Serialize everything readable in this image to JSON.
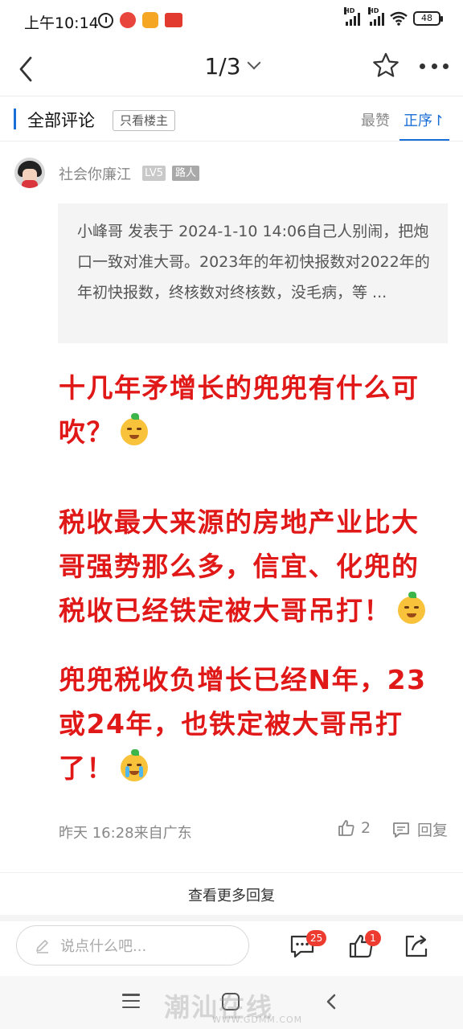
{
  "status_bar": {
    "time": "上午10:14",
    "net_label_1": "HD",
    "net_label_2": "HD",
    "battery": "48"
  },
  "nav": {
    "page_indicator": "1/3"
  },
  "comment_header": {
    "title": "全部评论",
    "filter_label": "只看楼主",
    "sort_hot": "最赞",
    "sort_order": "正序",
    "sort_order_arrow": "↾"
  },
  "comment": {
    "username": "社会你廉江",
    "level": "LV5",
    "role": "路人",
    "quote": "小峰哥 发表于 2024-1-10 14:06自己人别闹，把炮口一致对准大哥。2023年的年初快报数对2022年的年初快报数，终核数对终核数，没毛病，等 ...",
    "paragraphs": [
      "十几年矛增长的兜兜有什么可吹？",
      "税收最大来源的房地产业比大哥强势那么多，信宜、化兜的税收已经铁定被大哥吊打！",
      "兜兜税收负增长已经N年，23或24年，也铁定被大哥吊打了！"
    ],
    "time_location": "昨天 16:28来自广东",
    "like_count": "2",
    "reply_label": "回复"
  },
  "more_replies": "查看更多回复",
  "input_bar": {
    "placeholder": "说点什么吧...",
    "comments_badge": "25",
    "likes_badge": "1"
  },
  "watermark": {
    "text": "潮汕在线",
    "url": "WWW.GDMM.COM"
  }
}
